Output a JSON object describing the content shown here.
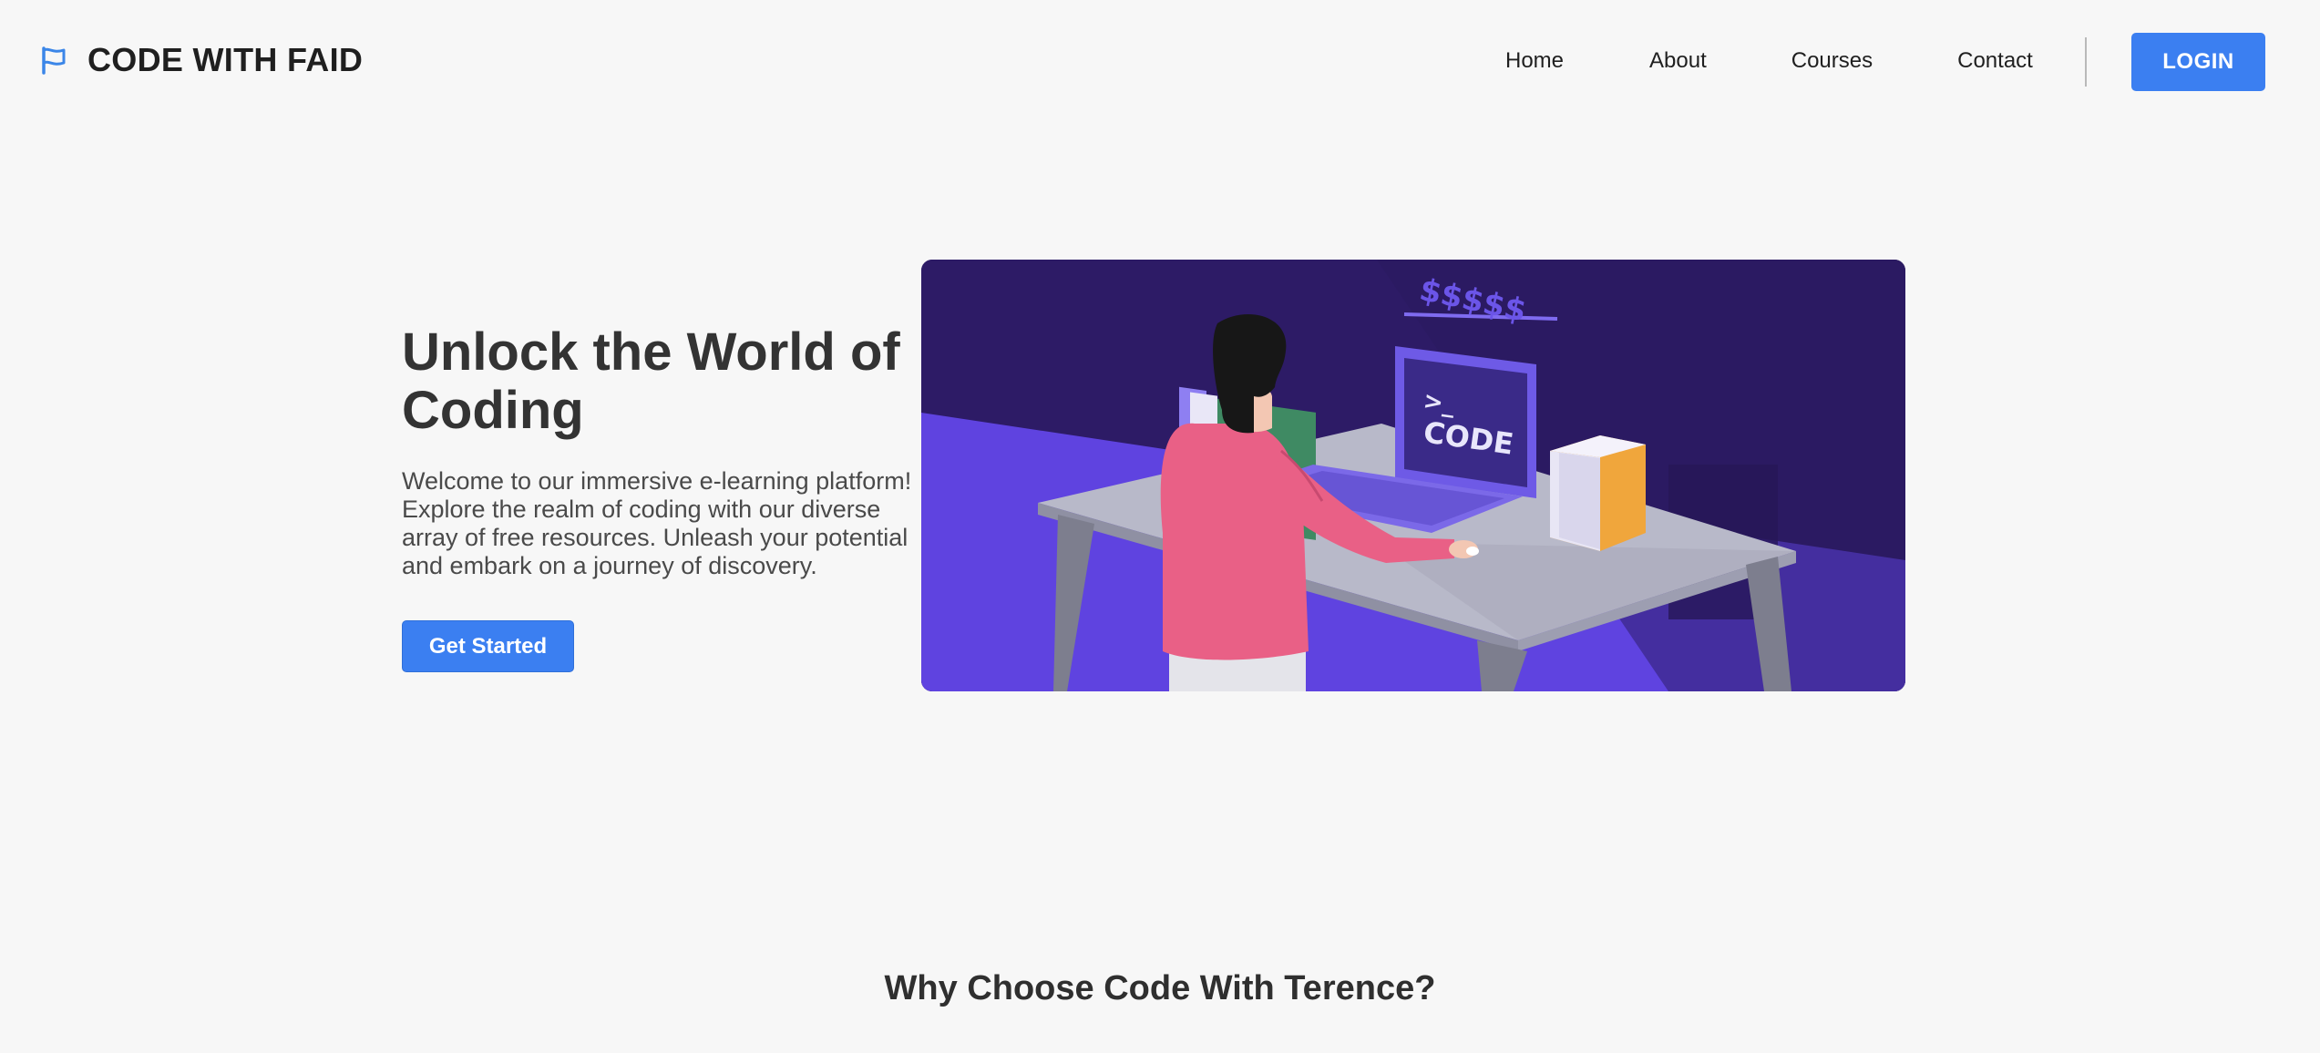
{
  "brand": {
    "name": "CODE WITH FAID",
    "icon": "flag-icon"
  },
  "nav": {
    "items": [
      {
        "label": "Home"
      },
      {
        "label": "About"
      },
      {
        "label": "Courses"
      },
      {
        "label": "Contact"
      }
    ],
    "login_label": "LOGIN"
  },
  "hero": {
    "title": "Unlock the World of Coding",
    "description": "Welcome to our immersive e-learning platform! Explore the realm of coding with our diverse array of free resources. Unleash your potential and embark on a journey of discovery.",
    "cta_label": "Get Started",
    "illustration": {
      "screen_prompt": ">_",
      "screen_text": "CODE",
      "floating_symbols": "$$$$$"
    }
  },
  "why": {
    "heading": "Why Choose Code With Terence?"
  },
  "colors": {
    "accent": "#3b7ff1",
    "background": "#f7f7f7",
    "illustration_bg": "#2d1b66",
    "illustration_purple": "#5f43e0"
  }
}
